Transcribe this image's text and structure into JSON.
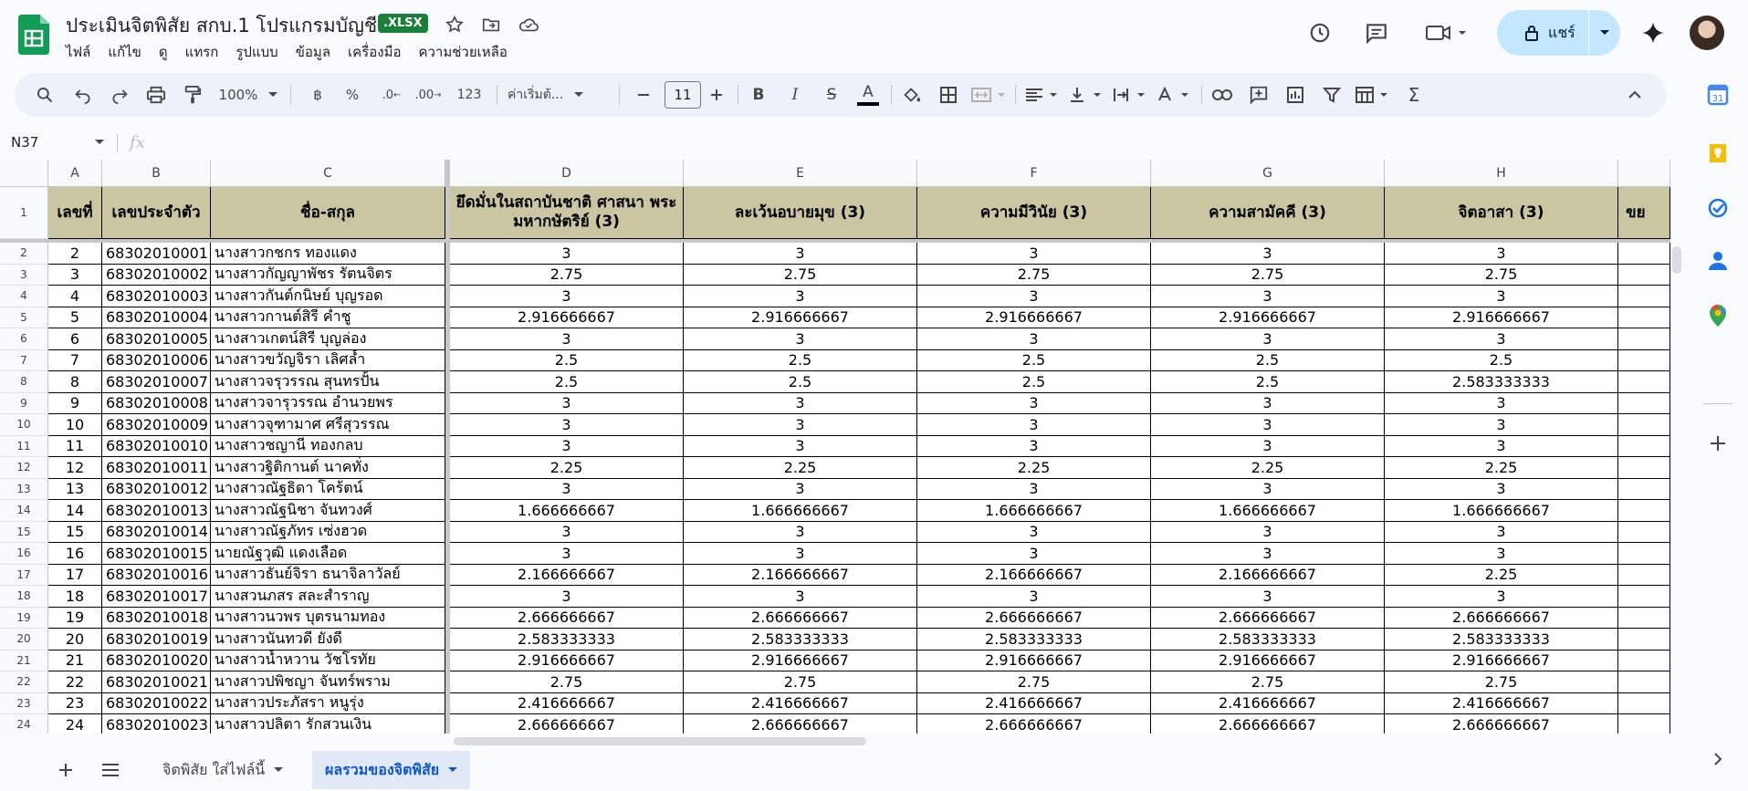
{
  "doc": {
    "title": "ประเมินจิตพิสัย สกบ.1 โปรแกรมบัญชี",
    "badge": ".XLSX"
  },
  "menu": [
    "ไฟล์",
    "แก้ไข",
    "ดู",
    "แทรก",
    "รูปแบบ",
    "ข้อมูล",
    "เครื่องมือ",
    "ความช่วยเหลือ"
  ],
  "header_actions": {
    "share_label": "แชร์"
  },
  "toolbar": {
    "zoom": "100%",
    "currency": "฿",
    "percent": "%",
    "dec_decrease": ".0",
    "dec_increase": ".00",
    "number_format": "123",
    "font": "ค่าเริ่มต้...",
    "font_size": "11",
    "bold": "B",
    "italic": "I",
    "strike": "S",
    "text_color": "A",
    "sum": "Σ"
  },
  "formula_bar": {
    "name_box": "N37",
    "fx": "fx"
  },
  "columns": [
    "A",
    "B",
    "C",
    "D",
    "E",
    "F",
    "G",
    "H"
  ],
  "header_row": {
    "row_number": "1",
    "cells": [
      "เลขที่",
      "เลขประจำตัว",
      "ชื่อ-สกุล",
      "ยึดมั่นในสถาบันชาติ ศาสนา พระมหากษัตริย์ (3)",
      "ละเว้นอบายมุข (3)",
      "ความมีวินัย (3)",
      "ความสามัคคี (3)",
      "จิตอาสา (3)",
      "ขย"
    ]
  },
  "rows": [
    {
      "r": "2",
      "c": [
        "2",
        "68302010001",
        "นางสาวกชกร    ทองแดง",
        "3",
        "3",
        "3",
        "3",
        "3"
      ]
    },
    {
      "r": "3",
      "c": [
        "3",
        "68302010002",
        "นางสาวกัญญาพัชร  รัตนจิตร",
        "2.75",
        "2.75",
        "2.75",
        "2.75",
        "2.75"
      ]
    },
    {
      "r": "4",
      "c": [
        "4",
        "68302010003",
        "นางสาวกันต์กนิษย์  บุญรอด",
        "3",
        "3",
        "3",
        "3",
        "3"
      ]
    },
    {
      "r": "5",
      "c": [
        "5",
        "68302010004",
        "นางสาวกานต์สิรี      ค่ำชู",
        "2.916666667",
        "2.916666667",
        "2.916666667",
        "2.916666667",
        "2.916666667"
      ]
    },
    {
      "r": "6",
      "c": [
        "6",
        "68302010005",
        "นางสาวเกตน์สิรี       บุญล่อง",
        "3",
        "3",
        "3",
        "3",
        "3"
      ]
    },
    {
      "r": "7",
      "c": [
        "7",
        "68302010006",
        "นางสาวขวัญจิรา       เลิศล้ำ",
        "2.5",
        "2.5",
        "2.5",
        "2.5",
        "2.5"
      ]
    },
    {
      "r": "8",
      "c": [
        "8",
        "68302010007",
        "นางสาวจรุวรรณ      สุนทรปั้น",
        "2.5",
        "2.5",
        "2.5",
        "2.5",
        "2.583333333"
      ]
    },
    {
      "r": "9",
      "c": [
        "9",
        "68302010008",
        "นางสาวจารุวรรณ     อำนวยพร",
        "3",
        "3",
        "3",
        "3",
        "3"
      ]
    },
    {
      "r": "10",
      "c": [
        "10",
        "68302010009",
        "นางสาวจุฑามาศ     ศรีสุวรรณ",
        "3",
        "3",
        "3",
        "3",
        "3"
      ]
    },
    {
      "r": "11",
      "c": [
        "11",
        "68302010010",
        "นางสาวชญานี         ทองกลบ",
        "3",
        "3",
        "3",
        "3",
        "3"
      ]
    },
    {
      "r": "12",
      "c": [
        "12",
        "68302010011",
        "นางสาวฐิติกานต์      นาคทั่ง",
        "2.25",
        "2.25",
        "2.25",
        "2.25",
        "2.25"
      ]
    },
    {
      "r": "13",
      "c": [
        "13",
        "68302010012",
        "นางสาวณัฐธิดา        โคร้ตน์",
        "3",
        "3",
        "3",
        "3",
        "3"
      ]
    },
    {
      "r": "14",
      "c": [
        "14",
        "68302010013",
        "นางสาวณัฐนิชา         จันทวงศ์",
        "1.666666667",
        "1.666666667",
        "1.666666667",
        "1.666666667",
        "1.666666667"
      ]
    },
    {
      "r": "15",
      "c": [
        "15",
        "68302010014",
        "นางสาวณัฐภัทร       เซ่งฮวด",
        "3",
        "3",
        "3",
        "3",
        "3"
      ]
    },
    {
      "r": "16",
      "c": [
        "16",
        "68302010015",
        "นายณัฐวุฒิ             แดงเลือด",
        "3",
        "3",
        "3",
        "3",
        "3"
      ]
    },
    {
      "r": "17",
      "c": [
        "17",
        "68302010016",
        "นางสาวธันย์จิรา     ธนาจิลาวัลย์",
        "2.166666667",
        "2.166666667",
        "2.166666667",
        "2.166666667",
        "2.25"
      ]
    },
    {
      "r": "18",
      "c": [
        "18",
        "68302010017",
        "นางสวนภสร      สละสำราญ",
        "3",
        "3",
        "3",
        "3",
        "3"
      ]
    },
    {
      "r": "19",
      "c": [
        "19",
        "68302010018",
        "นางสาวนวพร        บุตรนามทอง",
        "2.666666667",
        "2.666666667",
        "2.666666667",
        "2.666666667",
        "2.666666667"
      ]
    },
    {
      "r": "20",
      "c": [
        "20",
        "68302010019",
        "นางสาวนันทวดี     ยังดี",
        "2.583333333",
        "2.583333333",
        "2.583333333",
        "2.583333333",
        "2.583333333"
      ]
    },
    {
      "r": "21",
      "c": [
        "21",
        "68302010020",
        "นางสาวน้ำหวาน     วัชโรทัย",
        "2.916666667",
        "2.916666667",
        "2.916666667",
        "2.916666667",
        "2.916666667"
      ]
    },
    {
      "r": "22",
      "c": [
        "22",
        "68302010021",
        "นางสาวปพิชญา      จันทร์พราม",
        "2.75",
        "2.75",
        "2.75",
        "2.75",
        "2.75"
      ]
    },
    {
      "r": "23",
      "c": [
        "23",
        "68302010022",
        "นางสาวประภัสรา  หนูรุ่ง",
        "2.416666667",
        "2.416666667",
        "2.416666667",
        "2.416666667",
        "2.416666667"
      ]
    },
    {
      "r": "24",
      "c": [
        "24",
        "68302010023",
        "นางสาวปลิตา     รักสวนเงิน",
        "2.666666667",
        "2.666666667",
        "2.666666667",
        "2.666666667",
        "2.666666667"
      ]
    }
  ],
  "sheets": [
    {
      "label": "จิตพิสัย ใส่ไฟล์นี้",
      "active": false
    },
    {
      "label": "ผลรวมของจิตพิสัย",
      "active": true
    }
  ],
  "colors": {
    "header_fill": "#c9c6a1",
    "accent": "#0b57d0",
    "share_bg": "#c2e7ff",
    "xlsx_badge": "#188038"
  }
}
